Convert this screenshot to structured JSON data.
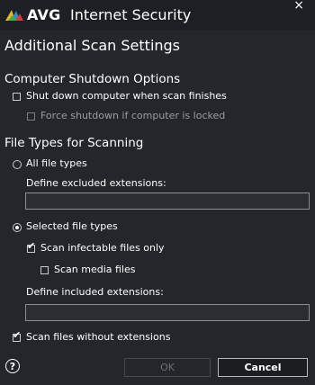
{
  "window": {
    "brand": "AVG",
    "product": "Internet Security",
    "close_icon": "×"
  },
  "page_title": "Additional Scan Settings",
  "shutdown": {
    "heading": "Computer Shutdown Options",
    "shutdown_label": "Shut down computer when scan finishes",
    "force_label": "Force shutdown if computer is locked"
  },
  "filetypes": {
    "heading": "File Types for Scanning",
    "all_label": "All file types",
    "excluded_label": "Define excluded extensions:",
    "excluded_value": "",
    "selected_label": "Selected file types",
    "infectable_label": "Scan infectable files only",
    "media_label": "Scan media files",
    "included_label": "Define included extensions:",
    "included_value": "",
    "noext_label": "Scan files without extensions"
  },
  "buttons": {
    "ok": "OK",
    "cancel": "Cancel",
    "help": "?"
  }
}
